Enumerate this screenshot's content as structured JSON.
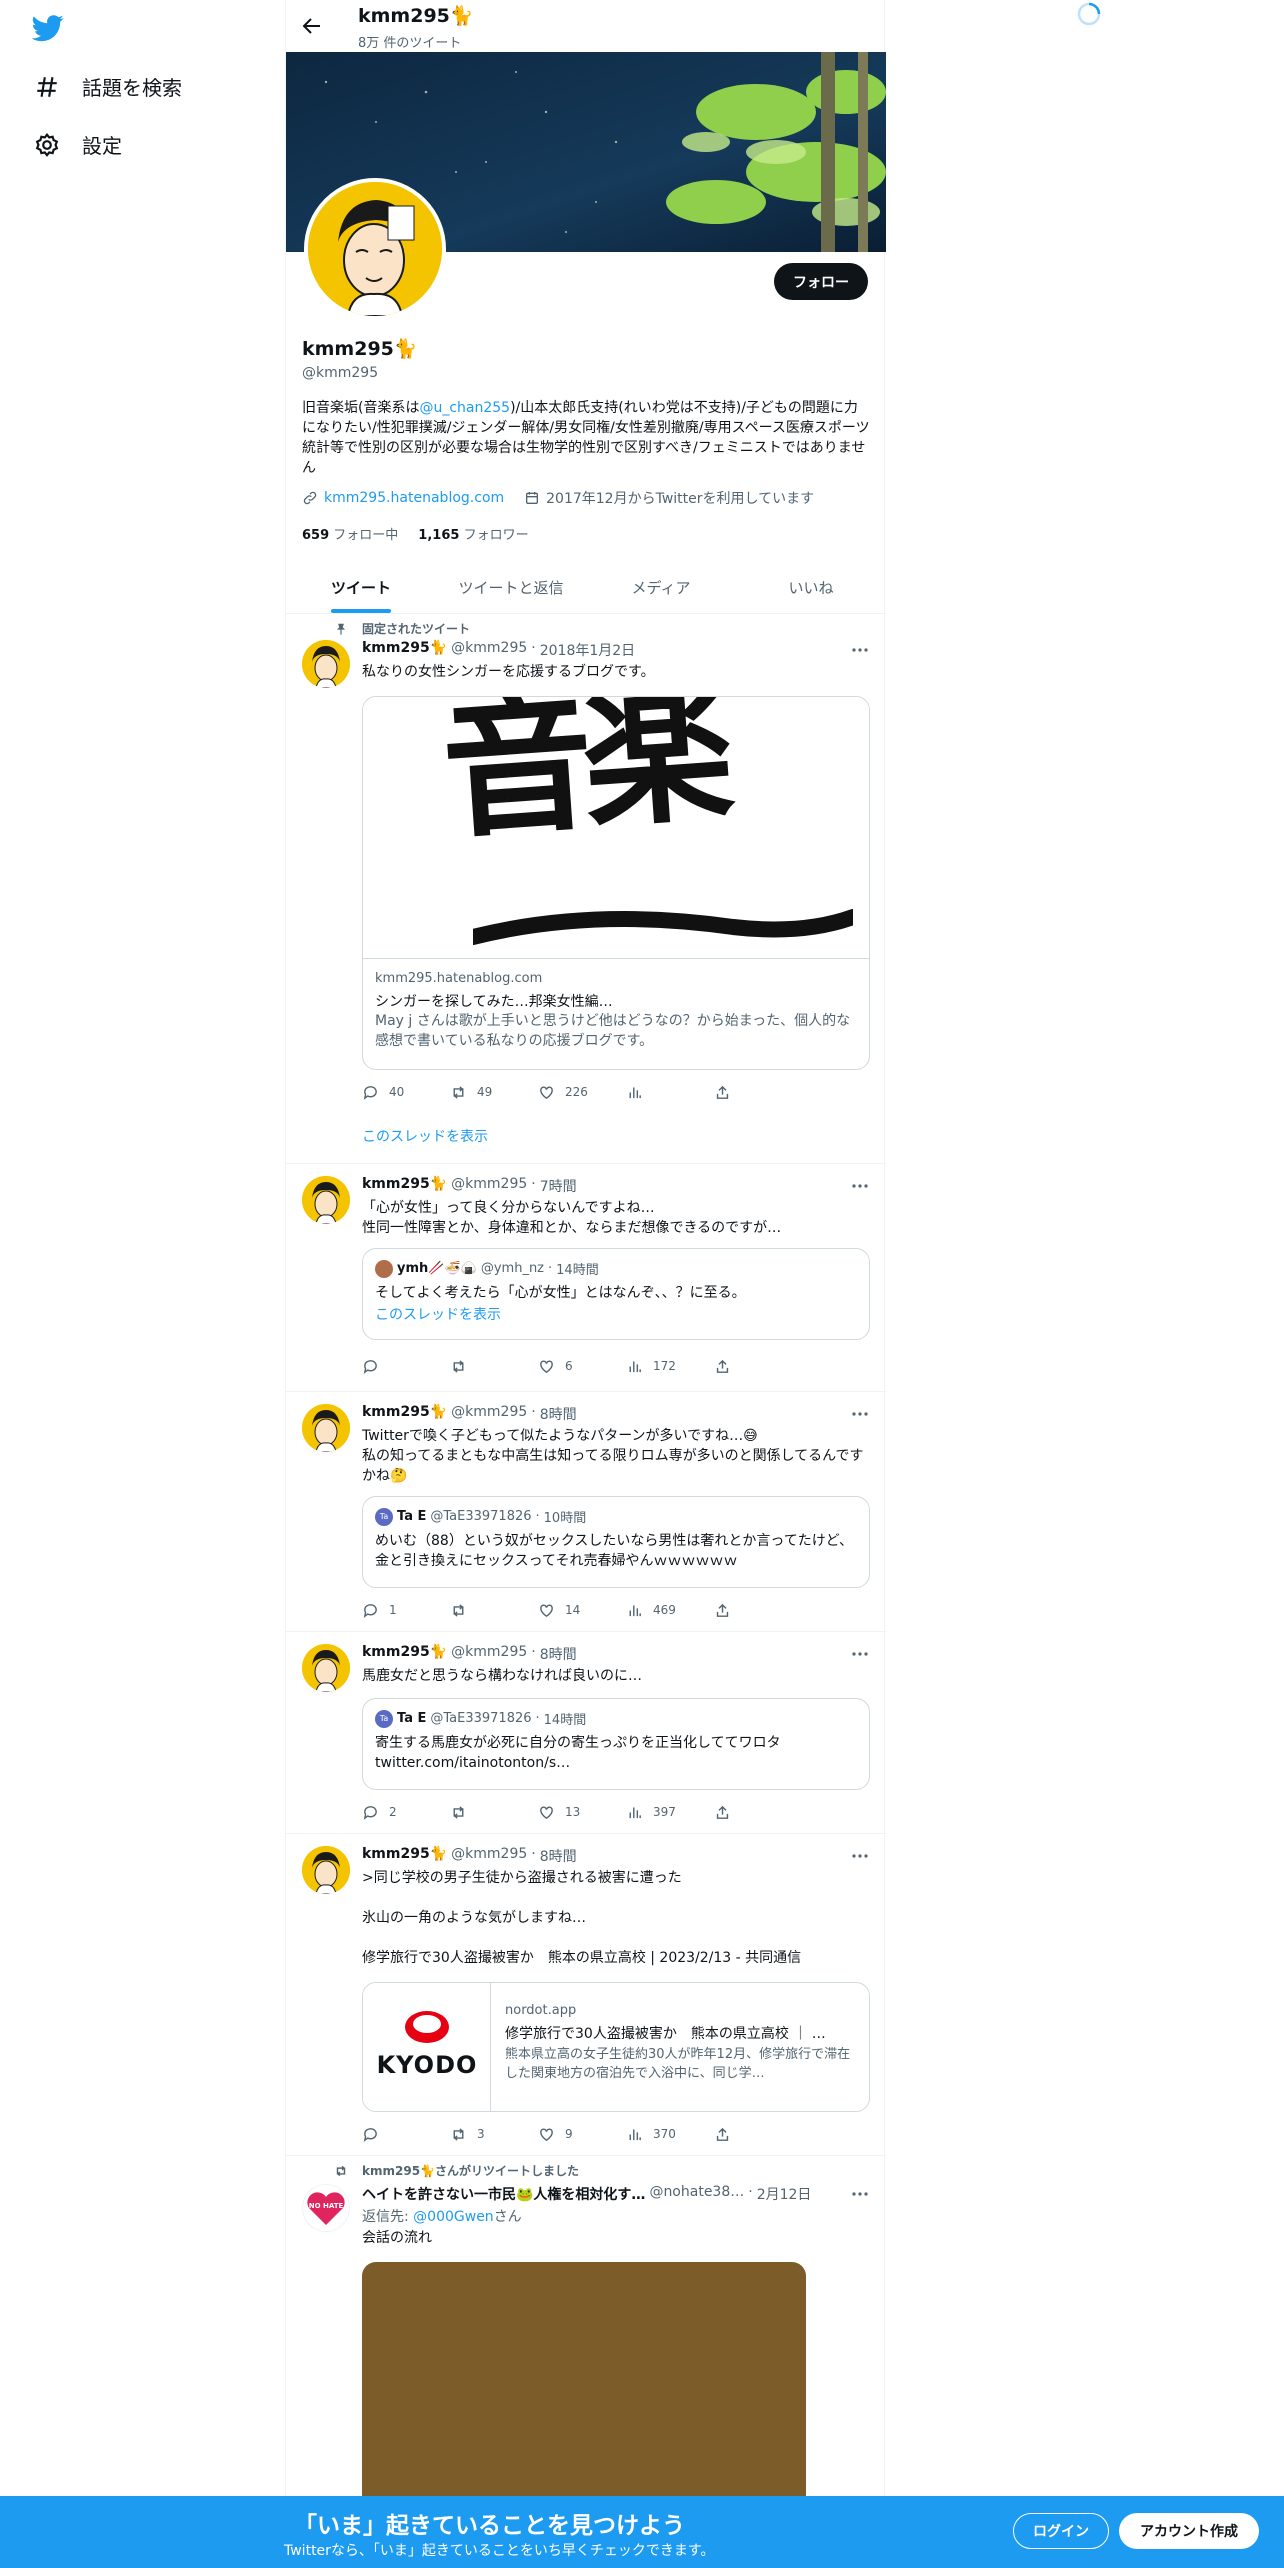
{
  "nav": {
    "explore_label": "話題を検索",
    "settings_label": "設定"
  },
  "profile": {
    "header_name": "kmm295🐈",
    "tweet_count": "8万 件のツイート",
    "follow_label": "フォロー",
    "name": "kmm295🐈",
    "handle": "@kmm295",
    "bio_pre": "旧音楽垢(音楽系は",
    "bio_mention": "@u_chan255",
    "bio_post": ")/山本太郎氏支持(れいわ党は不支持)/子どもの問題に力になりたい/性犯罪撲滅/ジェンダー解体/男女同権/女性差別撤廃/専用スペース医療スポーツ統計等で性別の区別が必要な場合は生物学的性別で区別すべき/フェミニストではありません",
    "website": "kmm295.hatenablog.com",
    "joined": "2017年12月からTwitterを利用しています",
    "following_count": "659",
    "following_label": "フォロー中",
    "followers_count": "1,165",
    "followers_label": "フォロワー"
  },
  "tabs": [
    "ツイート",
    "ツイートと返信",
    "メディア",
    "いいね"
  ],
  "tweets": [
    {
      "pinned_label": "固定されたツイート",
      "name": "kmm295🐈",
      "handle": "@kmm295",
      "time": "2018年1月2日",
      "text": "私なりの女性シンガーを応援するブログです。",
      "card_image_text": "音楽",
      "card_domain": "kmm295.hatenablog.com",
      "card_title": "シンガーを探してみた…邦楽女性編…",
      "card_desc": "May j さんは歌が上手いと思うけど他はどうなの？から始まった、個人的な感想で書いている私なりの応援ブログです。",
      "replies": "40",
      "retweets": "49",
      "likes": "226",
      "thread_label": "このスレッドを表示"
    },
    {
      "name": "kmm295🐈",
      "handle": "@kmm295",
      "time": "7時間",
      "text": "「心が女性」って良く分からないんですよね…\n性同一性障害とか、身体違和とか、ならまだ想像できるのですが…",
      "quote_name": "ymh🥢🍜🍙",
      "quote_handle": "@ymh_nz",
      "quote_time": "14時間",
      "quote_text": "そしてよく考えたら「心が女性」とはなんぞ、、？に至る。",
      "quote_thread": "このスレッドを表示",
      "replies": "",
      "retweets": "",
      "likes": "6",
      "views": "172"
    },
    {
      "name": "kmm295🐈",
      "handle": "@kmm295",
      "time": "8時間",
      "text": "Twitterで喚く子どもって似たようなパターンが多いですね…😅\n私の知ってるまともな中高生は知ってる限りロム専が多いのと関係してるんですかね🤔",
      "quote_avatar": "Ta",
      "quote_name": "Ta E",
      "quote_handle": "@TaE33971826",
      "quote_time": "10時間",
      "quote_text": "めいむ（88）という奴がセックスしたいなら男性は奢れとか言ってたけど、金と引き換えにセックスってそれ売春婦やんｗｗｗｗｗｗ",
      "replies": "1",
      "retweets": "",
      "likes": "14",
      "views": "469"
    },
    {
      "name": "kmm295🐈",
      "handle": "@kmm295",
      "time": "8時間",
      "text": "馬鹿女だと思うなら構わなければ良いのに…",
      "quote_avatar": "Ta",
      "quote_name": "Ta E",
      "quote_handle": "@TaE33971826",
      "quote_time": "14時間",
      "quote_text": "寄生する馬鹿女が必死に自分の寄生っぷりを正当化しててワロタ\ntwitter.com/itainotonton/s…",
      "replies": "2",
      "retweets": "",
      "likes": "13",
      "views": "397"
    },
    {
      "name": "kmm295🐈",
      "handle": "@kmm295",
      "time": "8時間",
      "text": ">同じ学校の男子生徒から盗撮される被害に遭った\n\n氷山の一角のような気がしますね…\n\n修学旅行で30人盗撮被害か　熊本の県立高校 | 2023/2/13 - 共同通信",
      "card_logo": "KYODO",
      "card_domain": "nordot.app",
      "card_title": "修学旅行で30人盗撮被害か　熊本の県立高校 ｜ …",
      "card_desc": "熊本県立高の女子生徒約30人が昨年12月、修学旅行で滞在した関東地方の宿泊先で入浴中に、同じ学…",
      "replies": "",
      "retweets": "3",
      "likes": "9",
      "views": "370"
    },
    {
      "retweet_label": "kmm295🐈さんがリツイートしました",
      "avatar_text": "NO HATE",
      "name": "ヘイトを許さない一市民🐸人権を相対化す…",
      "handle": "@nohate38…",
      "time": "2月12日",
      "reply_to_label": "返信先:",
      "reply_to_handle": "@000Gwen",
      "reply_to_suffix": "さん",
      "text": "会話の流れ"
    }
  ],
  "bottom_bar": {
    "title": "「いま」起きていることを見つけよう",
    "subtitle": "Twitterなら、「いま」起きていることをいち早くチェックできます。",
    "login_label": "ログイン",
    "signup_label": "アカウント作成"
  },
  "colors": {
    "accent": "#1d9bf0",
    "text": "#0f1419",
    "muted": "#536471",
    "bottom_bar": "#1d9bf0",
    "retweet_image_bg": "#7c5c28"
  }
}
